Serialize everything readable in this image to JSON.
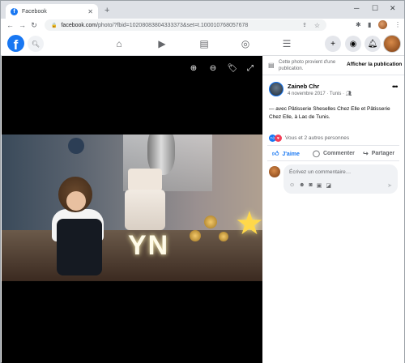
{
  "browser": {
    "tab_title": "Facebook",
    "tab_close": "✕",
    "new_tab": "+",
    "url_main": "facebook.com",
    "url_path": "/photo/?fbid=10208083804333373&set=t.100010768057678",
    "icons": [
      "back-icon",
      "forward-icon",
      "reload-icon",
      "lock-icon",
      "share-icon",
      "star-icon",
      "extensions-icon",
      "sidepanel-icon",
      "profile-icon",
      "menu-icon"
    ],
    "window_controls": [
      "minimize-icon",
      "maximize-icon",
      "close-icon"
    ]
  },
  "facebook_header": {
    "logo": "f",
    "brand_color": "#1877f2",
    "nav_icons": [
      "home-icon",
      "watch-icon",
      "marketplace-icon",
      "groups-icon",
      "menu-icon"
    ],
    "right_icons": [
      "create-icon",
      "messenger-icon",
      "notifications-icon",
      "account-avatar"
    ]
  },
  "viewer": {
    "controls": [
      "zoom-in-icon",
      "zoom-out-icon",
      "tag-icon",
      "fullscreen-icon"
    ],
    "photo_letters": "YN"
  },
  "panel": {
    "notice_text": "Cette photo provient d'une publication.",
    "notice_button": "Afficher la publication",
    "author": "Zaineb Chr",
    "date": "4 novembre 2017 · Tunis · ",
    "caption_prefix": "— avec ",
    "caption_person1": "Pâtisserie Sheselles Chez Elle",
    "caption_and": " et ",
    "caption_person2": "Pâtisserie Chez Elle",
    "caption_at": ", à ",
    "caption_place": "Lac de Tunis",
    "caption_end": ".",
    "reactions_text": "Vous et 2 autres personnes",
    "like_label": "J'aime",
    "comment_label": "Commenter",
    "share_label": "Partager",
    "comment_placeholder": "Écrivez un commentaire…",
    "like_color": "#1877f2",
    "love_color": "#f33e58"
  }
}
